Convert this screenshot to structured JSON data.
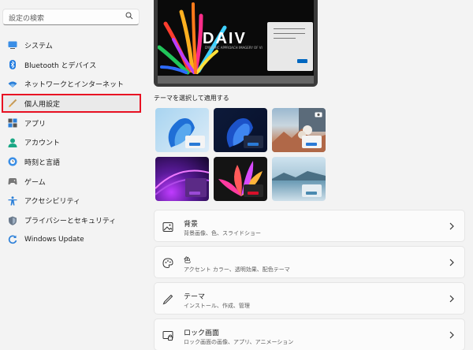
{
  "search": {
    "placeholder": "設定の検索"
  },
  "sidebar": {
    "items": [
      {
        "label": "システム",
        "icon": "monitor-icon"
      },
      {
        "label": "Bluetooth とデバイス",
        "icon": "bluetooth-icon"
      },
      {
        "label": "ネットワークとインターネット",
        "icon": "wifi-icon"
      },
      {
        "label": "個人用設定",
        "icon": "brush-icon",
        "selected": true
      },
      {
        "label": "アプリ",
        "icon": "apps-icon"
      },
      {
        "label": "アカウント",
        "icon": "person-icon"
      },
      {
        "label": "時刻と言語",
        "icon": "globe-clock-icon"
      },
      {
        "label": "ゲーム",
        "icon": "gamepad-icon"
      },
      {
        "label": "アクセシビリティ",
        "icon": "accessibility-icon"
      },
      {
        "label": "プライバシーとセキュリティ",
        "icon": "shield-icon"
      },
      {
        "label": "Windows Update",
        "icon": "update-icon"
      }
    ]
  },
  "preview": {
    "logo_text": "DAIV",
    "tagline": "DYNAMIC APPROACH IMAGERY OF VI"
  },
  "themes": {
    "title": "テーマを選択して適用する",
    "items": [
      "theme-1",
      "theme-2",
      "theme-3",
      "theme-4",
      "theme-5",
      "theme-6"
    ]
  },
  "cards": [
    {
      "title": "背景",
      "subtitle": "背景画像、色、スライドショー",
      "icon": "image-icon"
    },
    {
      "title": "色",
      "subtitle": "アクセント カラー、透明効果、配色テーマ",
      "icon": "palette-icon"
    },
    {
      "title": "テーマ",
      "subtitle": "インストール、作成、管理",
      "icon": "pen-icon"
    },
    {
      "title": "ロック画面",
      "subtitle": "ロック画面の画像、アプリ、アニメーション",
      "icon": "lock-screen-icon"
    }
  ],
  "colors": {
    "accent": "#0067c0",
    "highlight": "#e81123"
  }
}
